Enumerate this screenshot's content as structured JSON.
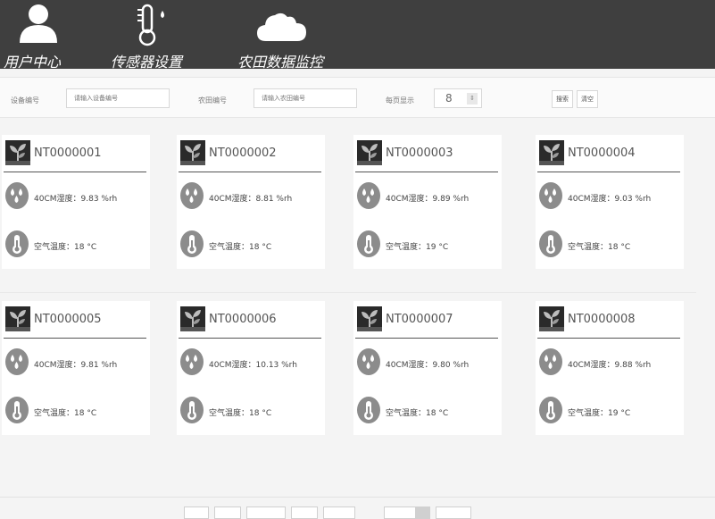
{
  "nav": {
    "user_center": "用户中心",
    "sensor_settings": "传感器设置",
    "farm_monitoring": "农田数据监控"
  },
  "filters": {
    "device_label": "设备编号",
    "device_placeholder": "请输入设备编号",
    "farm_label": "农田编号",
    "farm_placeholder": "请输入农田编号",
    "page_size_label": "每页显示",
    "page_size_value": "8",
    "page_size_arrow": "⇕",
    "search_button": "搜索",
    "clear_button": "清空"
  },
  "cards": [
    {
      "id": "NT0000001",
      "humidity": "40CM湿度：9.83 %rh",
      "temperature": "空气温度：18 °C"
    },
    {
      "id": "NT0000002",
      "humidity": "40CM湿度：8.81 %rh",
      "temperature": "空气温度：18 °C"
    },
    {
      "id": "NT0000003",
      "humidity": "40CM湿度：9.89 %rh",
      "temperature": "空气温度：19 °C"
    },
    {
      "id": "NT0000004",
      "humidity": "40CM湿度：9.03 %rh",
      "temperature": "空气温度：18 °C"
    },
    {
      "id": "NT0000005",
      "humidity": "40CM湿度：9.81 %rh",
      "temperature": "空气温度：18 °C"
    },
    {
      "id": "NT0000006",
      "humidity": "40CM湿度：10.13 %rh",
      "temperature": "空气温度：18 °C"
    },
    {
      "id": "NT0000007",
      "humidity": "40CM湿度：9.80 %rh",
      "temperature": "空气温度：18 °C"
    },
    {
      "id": "NT0000008",
      "humidity": "40CM湿度：9.88 %rh",
      "temperature": "空气温度：19 °C"
    }
  ],
  "colors": {
    "topbar": "#3f3f3f",
    "nav_text": "#ffffff",
    "card_bg": "#ffffff",
    "page_bg": "#f4f4f4",
    "icon_gray": "#8c8c8c"
  },
  "icons": {
    "user": "user-icon",
    "sensor": "thermometer-icon",
    "farm": "cloud-icon",
    "device": "plant-icon",
    "humidity": "water-drops-icon",
    "temperature": "thermometer-icon"
  }
}
